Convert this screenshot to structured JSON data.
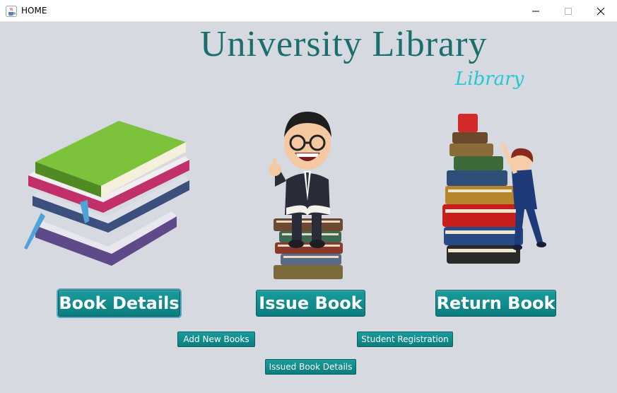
{
  "window": {
    "title": "HOME",
    "icon": "java-cup-icon",
    "controls": [
      "minimize-icon",
      "maximize-icon",
      "close-icon"
    ]
  },
  "header": {
    "title": "University Library",
    "subtitle": "Library"
  },
  "buttons": {
    "book_details": "Book Details",
    "issue_book": "Issue Book",
    "return_book": "Return Book",
    "add_new_books": "Add New Books",
    "student_registration": "Student Registration",
    "issued_book_details": "Issued Book Details"
  },
  "colors": {
    "background": "#d6d9e0",
    "title": "#1a6e6e",
    "subtitle": "#25c8cf",
    "button": "#0b7d7e"
  }
}
